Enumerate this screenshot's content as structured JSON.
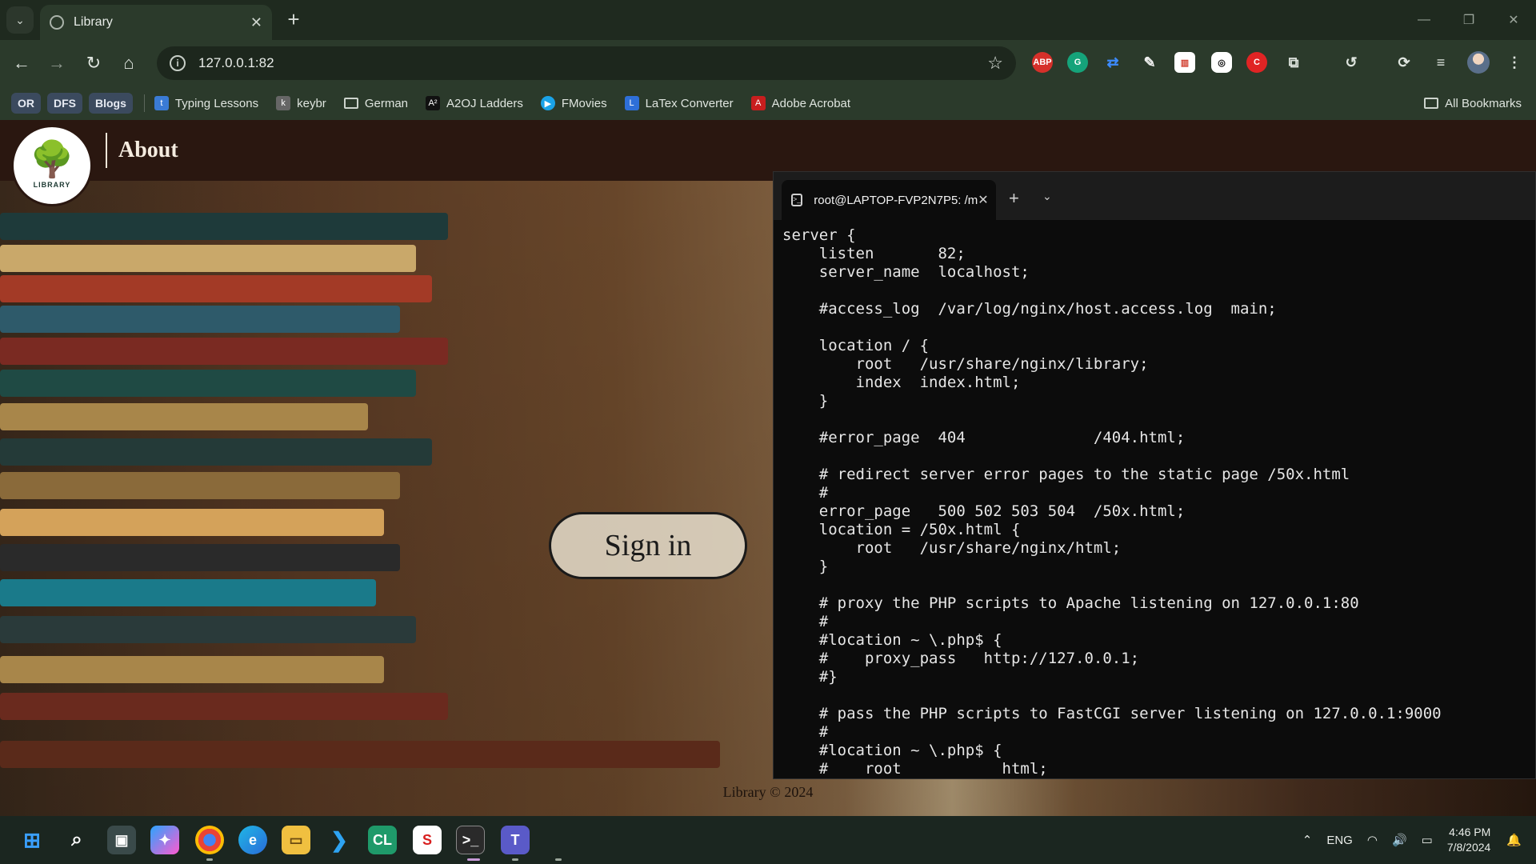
{
  "browser": {
    "tab_title": "Library",
    "url": "127.0.0.1:82",
    "bookmark_chips": [
      "OR",
      "DFS",
      "Blogs"
    ],
    "bookmarks": [
      {
        "label": "Typing Lessons",
        "icon": "typing-icon"
      },
      {
        "label": "keybr",
        "icon": "keybr-icon"
      },
      {
        "label": "German",
        "icon": "folder-icon"
      },
      {
        "label": "A2OJ Ladders",
        "icon": "a2oj-icon"
      },
      {
        "label": "FMovies",
        "icon": "play-icon"
      },
      {
        "label": "LaTex Converter",
        "icon": "latex-icon"
      },
      {
        "label": "Adobe Acrobat",
        "icon": "acrobat-icon"
      }
    ],
    "all_bookmarks": "All Bookmarks",
    "extensions": [
      "ABP",
      "grammarly-icon",
      "translate-icon",
      "eyedropper-icon",
      "chart-icon",
      "openai-icon",
      "red-ext-icon",
      "puzzle-icon"
    ]
  },
  "page": {
    "logo_text": "LIBRARY",
    "nav_about": "About",
    "signin_label": "Sign in",
    "footer": "Library © 2024"
  },
  "terminal": {
    "tab_title": "root@LAPTOP-FVP2N7P5: /m",
    "lines": [
      "server {",
      "    listen       82;",
      "    server_name  localhost;",
      "",
      "    #access_log  /var/log/nginx/host.access.log  main;",
      "",
      "    location / {",
      "        root   /usr/share/nginx/library;",
      "        index  index.html;",
      "    }",
      "",
      "    #error_page  404              /404.html;",
      "",
      "    # redirect server error pages to the static page /50x.html",
      "    #",
      "    error_page   500 502 503 504  /50x.html;",
      "    location = /50x.html {",
      "        root   /usr/share/nginx/html;",
      "    }",
      "",
      "    # proxy the PHP scripts to Apache listening on 127.0.0.1:80",
      "    #",
      "    #location ~ \\.php$ {",
      "    #    proxy_pass   http://127.0.0.1;",
      "    #}",
      "",
      "    # pass the PHP scripts to FastCGI server listening on 127.0.0.1:9000",
      "    #",
      "    #location ~ \\.php$ {",
      "    #    root           html;"
    ]
  },
  "taskbar": {
    "tray_lang": "ENG",
    "time": "4:46 PM",
    "date": "7/8/2024"
  },
  "colors": {
    "browser_frame": "#2b3a2b",
    "page_header": "#2a1710",
    "terminal_bg": "#0c0c0c",
    "taskbar": "#1b2620"
  }
}
